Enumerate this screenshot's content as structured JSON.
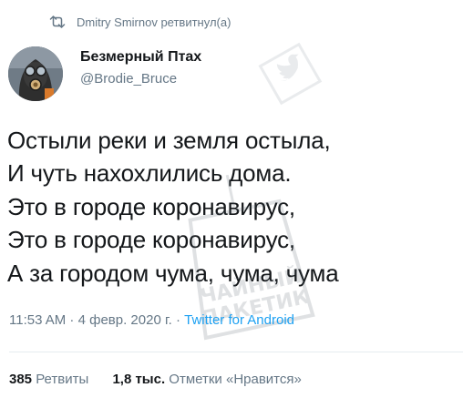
{
  "retweet": {
    "text": "Dmitry Smirnov ретвитнул(а)",
    "icon": "retweet-icon"
  },
  "author": {
    "name": "Безмерный Птах",
    "handle": "@Brodie_Bruce",
    "avatar": "gas-mask-avatar"
  },
  "tweet": {
    "lines": [
      "Остыли реки и земля остыла,",
      "И чуть нахохлились дома.",
      "Это в городе коронавирус,",
      "Это в городе коронавирус,",
      "А за городом чума, чума, чума"
    ]
  },
  "meta": {
    "timestamp": "11:53 AM · 4 февр. 2020 г. · ",
    "source": "Twitter for Android"
  },
  "stats": {
    "retweets_count": "385",
    "retweets_label": "Ретвиты",
    "likes_count": "1,8 тыс.",
    "likes_label": "Отметки «Нравится»"
  },
  "watermark": {
    "text_line1": "ЧАЙНЫЙ",
    "text_line2": "ПАКЕТИК"
  },
  "colors": {
    "text": "#14171a",
    "secondary": "#657786",
    "link": "#1da1f2",
    "divider": "#e6ecf0"
  }
}
